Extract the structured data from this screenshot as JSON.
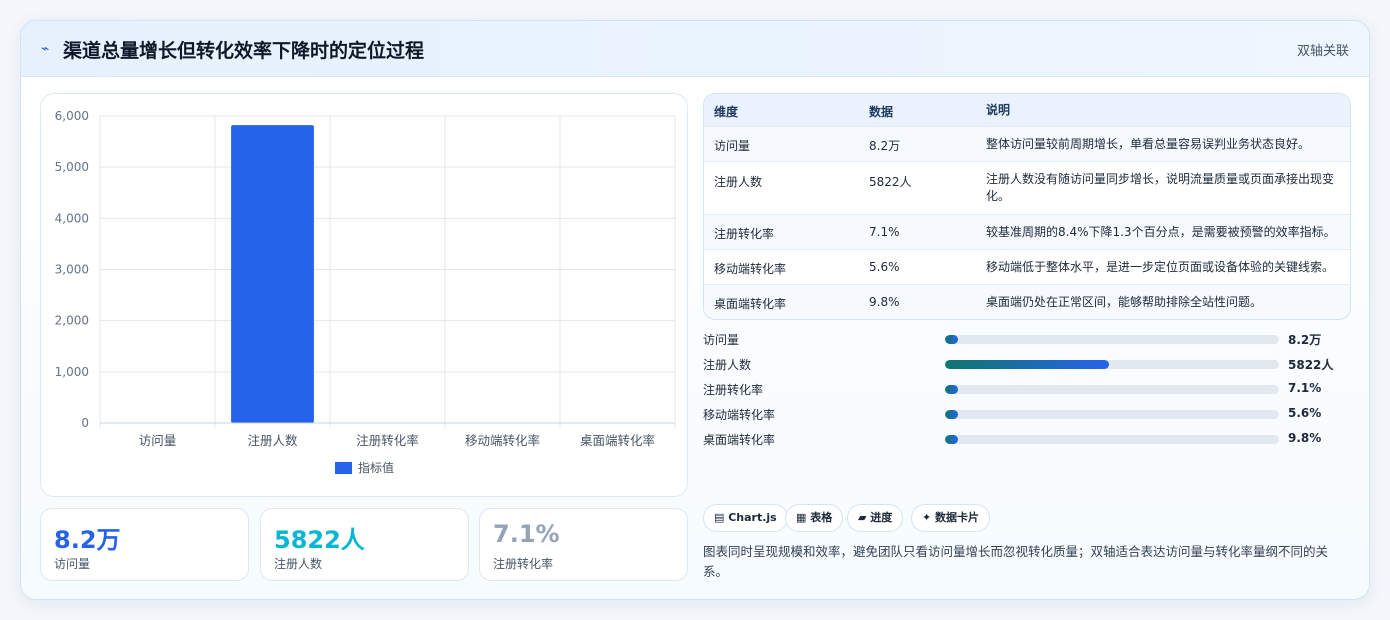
{
  "header": {
    "icon": "chart-spark-icon",
    "title": "渠道总量增长但转化效率下降时的定位过程",
    "tag": "双轴关联"
  },
  "chart_data": {
    "type": "bar",
    "categories": [
      "访问量",
      "注册人数",
      "注册转化率",
      "移动端转化率",
      "桌面端转化率"
    ],
    "series": [
      {
        "name": "指标值",
        "values": [
          0,
          5822,
          0,
          0,
          0
        ]
      }
    ],
    "ylim": [
      0,
      6000
    ],
    "yticks": [
      "0",
      "1,000",
      "2,000",
      "3,000",
      "4,000",
      "5,000",
      "6,000"
    ],
    "grid": true,
    "legend": "bottom",
    "color": "#2563eb"
  },
  "kpis": [
    {
      "value": "8.2万",
      "label": "访问量",
      "color": "#2563eb"
    },
    {
      "value": "5822人",
      "label": "注册人数",
      "color": "#06b6d4"
    },
    {
      "value": "7.1%",
      "label": "注册转化率",
      "color": "#94a3b8"
    }
  ],
  "table": {
    "headers": [
      "维度",
      "数据",
      "说明"
    ],
    "rows": [
      [
        "访问量",
        "8.2万",
        "整体访问量较前周期增长，单看总量容易误判业务状态良好。"
      ],
      [
        "注册人数",
        "5822人",
        "注册人数没有随访问量同步增长，说明流量质量或页面承接出现变化。"
      ],
      [
        "注册转化率",
        "7.1%",
        "较基准周期的8.4%下降1.3个百分点，是需要被预警的效率指标。"
      ],
      [
        "移动端转化率",
        "5.6%",
        "移动端低于整体水平，是进一步定位页面或设备体验的关键线索。"
      ],
      [
        "桌面端转化率",
        "9.8%",
        "桌面端仍处在正常区间，能够帮助排除全站性问题。"
      ]
    ]
  },
  "progress": [
    {
      "label": "访问量",
      "value": "8.2万",
      "fraction": 0.01
    },
    {
      "label": "注册人数",
      "value": "5822人",
      "fraction": 0.49
    },
    {
      "label": "注册转化率",
      "value": "7.1%",
      "fraction": 0.01
    },
    {
      "label": "移动端转化率",
      "value": "5.6%",
      "fraction": 0.01
    },
    {
      "label": "桌面端转化率",
      "value": "9.8%",
      "fraction": 0.02
    }
  ],
  "chips": [
    {
      "icon": "chart-icon",
      "label": "▤ Chart.js"
    },
    {
      "icon": "table-icon",
      "label": "▦ 表格"
    },
    {
      "icon": "progress-icon",
      "label": "▰ 进度"
    },
    {
      "icon": "card-icon",
      "label": "✦ 数据卡片"
    }
  ],
  "note": "图表同时呈现规模和效率，避免团队只看访问量增长而忽视转化质量；双轴适合表达访问量与转化率量纲不同的关系。"
}
